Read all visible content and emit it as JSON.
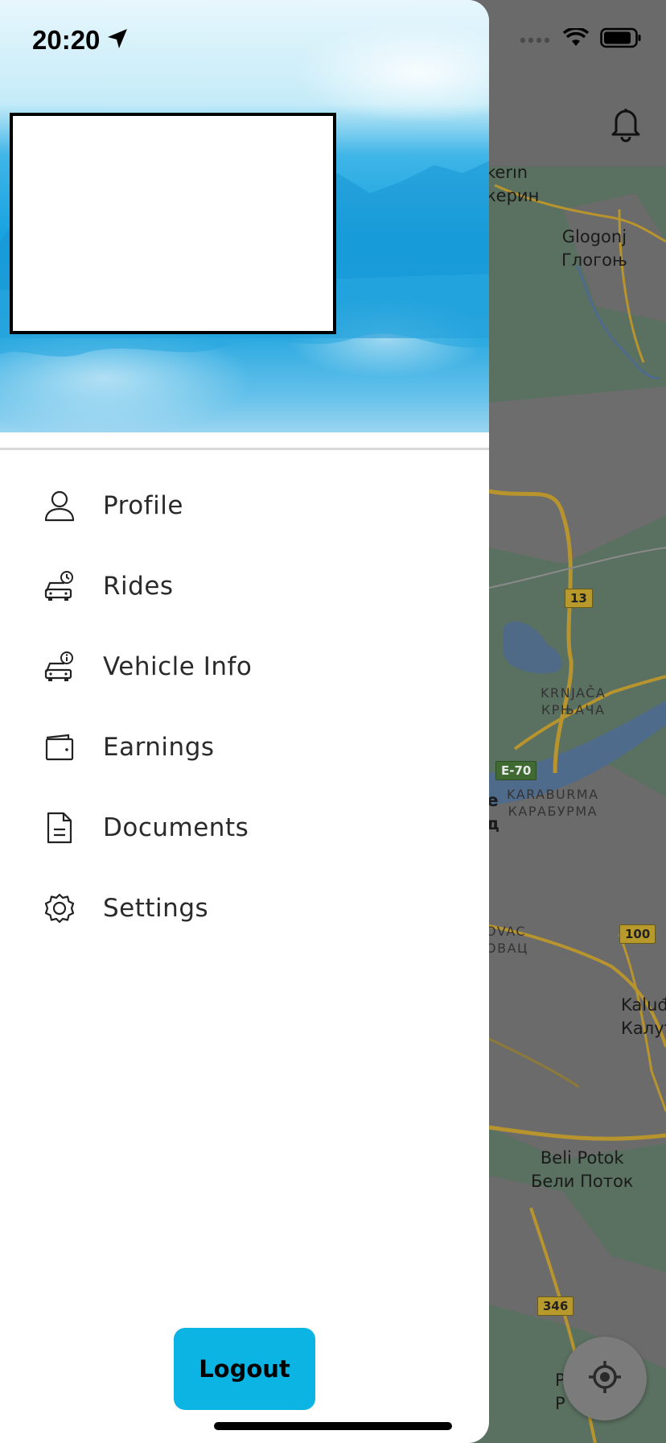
{
  "status_bar": {
    "time": "20:20",
    "icons": [
      "location-arrow-icon",
      "signal-icon",
      "wifi-icon",
      "battery-icon"
    ]
  },
  "drawer": {
    "menu": [
      {
        "label": "Profile",
        "icon": "person-icon"
      },
      {
        "label": "Rides",
        "icon": "car-clock-icon"
      },
      {
        "label": "Vehicle Info",
        "icon": "car-info-icon"
      },
      {
        "label": "Earnings",
        "icon": "wallet-icon"
      },
      {
        "label": "Documents",
        "icon": "document-icon"
      },
      {
        "label": "Settings",
        "icon": "gear-icon"
      }
    ],
    "logout_label": "Logout",
    "colors": {
      "logout_bg": "#0BB4E2",
      "header_blue": "#16A3E0"
    }
  },
  "map": {
    "labels": [
      {
        "latin": "kerin",
        "cyrillic": "керин"
      },
      {
        "latin": "Glogonj",
        "cyrillic": "Глогоњ"
      },
      {
        "latin": "KRNJAČA",
        "cyrillic": "КРЊАЧА"
      },
      {
        "latin": "KARABURMA",
        "cyrillic": "КАРАБУРМА"
      },
      {
        "latin": "e",
        "cyrillic": "д"
      },
      {
        "latin": "OVAC",
        "cyrillic": "ОВАЦ"
      },
      {
        "latin": "Kaluđ",
        "cyrillic": "Калуђ"
      },
      {
        "latin": "Beli Potok",
        "cyrillic": "Бели Поток"
      },
      {
        "latin": "P",
        "cyrillic": "Р"
      }
    ],
    "road_shields": [
      "13",
      "E-70",
      "100",
      "346"
    ]
  },
  "topbar": {
    "notification_icon": "bell-icon"
  },
  "locate_icon": "crosshair-icon"
}
